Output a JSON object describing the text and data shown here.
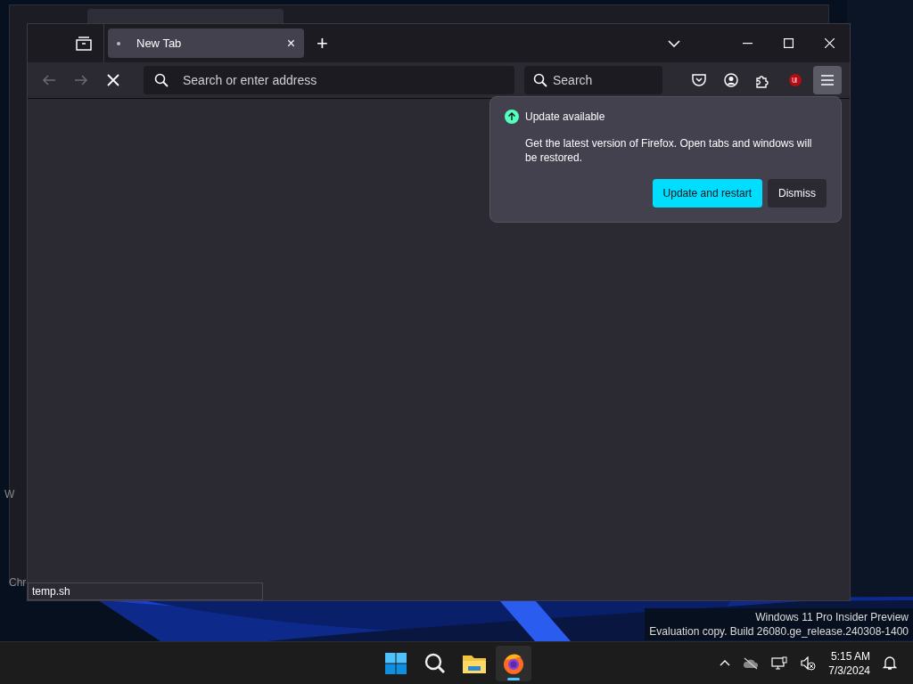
{
  "background_window": {
    "fragments": [
      "W",
      "Chr"
    ]
  },
  "window": {
    "tabs": [
      {
        "label": "New Tab",
        "selected": true,
        "close_glyph": "×"
      }
    ],
    "new_tab_glyph": "+",
    "address_placeholder": "Search or enter address",
    "search_placeholder": "Search",
    "loading": true
  },
  "update_popup": {
    "title": "Update available",
    "message": "Get the latest version of Firefox. Open tabs and windows will be restored.",
    "buttons": [
      {
        "label": "Update and restart",
        "kind": "primary"
      },
      {
        "label": "Dismiss",
        "kind": "secondary"
      }
    ]
  },
  "status_text": "temp.sh",
  "desktop_notice": [
    "Windows 11 Pro Insider Preview",
    "Evaluation copy. Build 26080.ge_release.240308-1400"
  ],
  "taskbar": {
    "apps": [
      {
        "kind": "start",
        "selected": false
      },
      {
        "kind": "search",
        "selected": false
      },
      {
        "kind": "explorer",
        "selected": false
      },
      {
        "kind": "firefox",
        "selected": true
      }
    ],
    "time": "5:15 AM",
    "date": "7/3/2024"
  }
}
